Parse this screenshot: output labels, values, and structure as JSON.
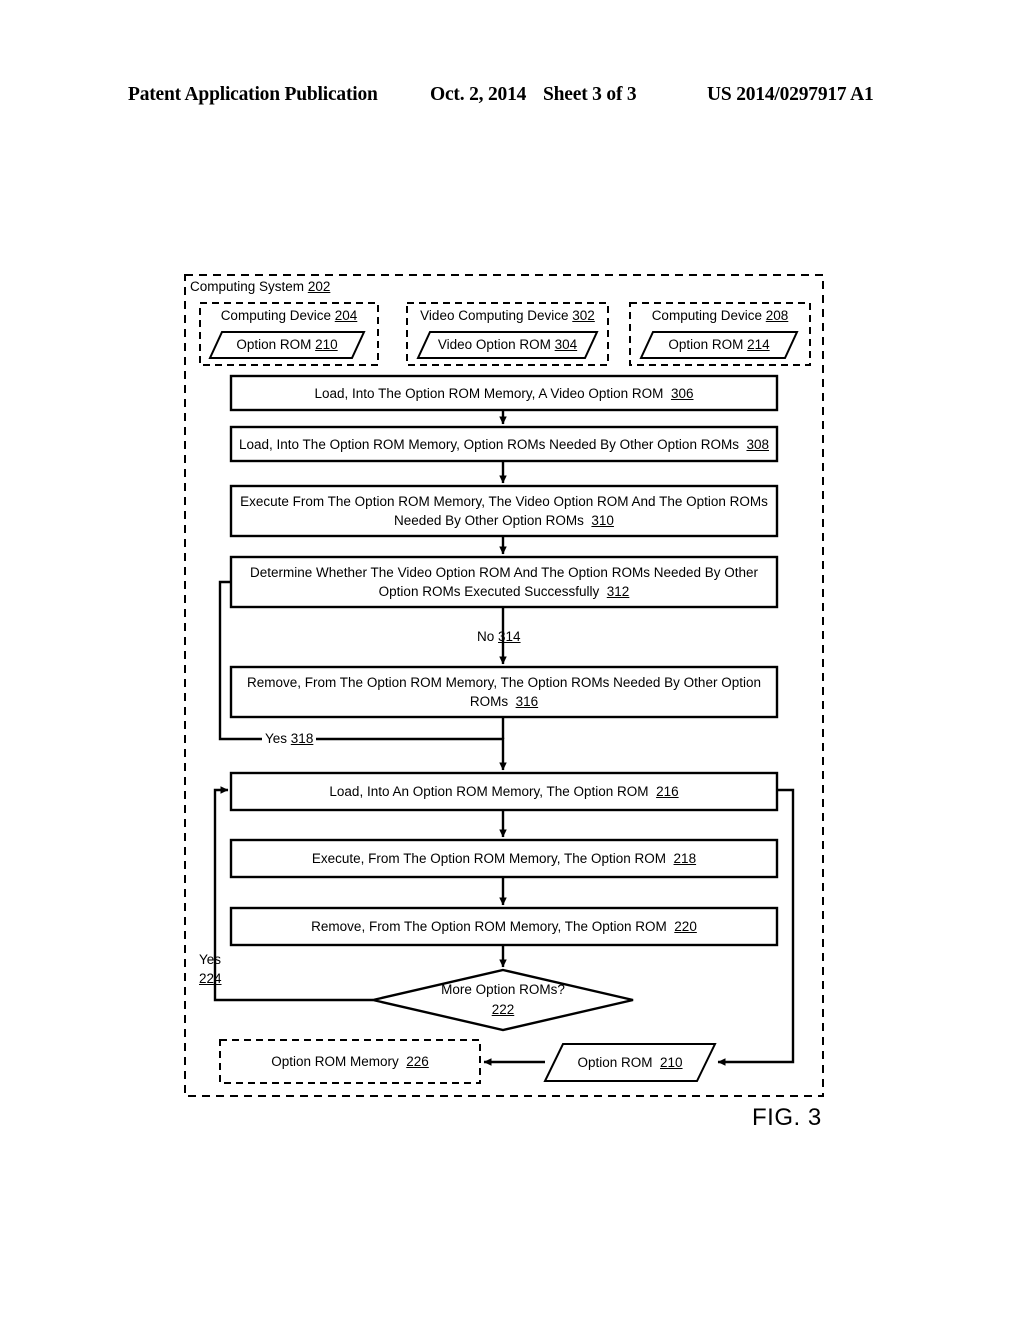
{
  "header": {
    "publication": "Patent Application Publication",
    "date": "Oct. 2, 2014",
    "sheet": "Sheet 3 of 3",
    "patent_number": "US 2014/0297917 A1"
  },
  "figure": {
    "caption": "FIG. 3",
    "system": {
      "title": "Computing System",
      "ref": "202"
    },
    "devices": [
      {
        "title": "Computing Device",
        "ref": "204",
        "rom_label": "Option ROM",
        "rom_ref": "210"
      },
      {
        "title": "Video Computing Device",
        "ref": "302",
        "rom_label": "Video Option ROM",
        "rom_ref": "304"
      },
      {
        "title": "Computing Device",
        "ref": "208",
        "rom_label": "Option ROM",
        "rom_ref": "214"
      }
    ],
    "steps": [
      {
        "id": "step-306",
        "text": "Load, Into The Option ROM Memory, A Video Option ROM",
        "ref": "306"
      },
      {
        "id": "step-308",
        "text": "Load, Into The Option ROM Memory, Option ROMs Needed By Other Option ROMs",
        "ref": "308"
      },
      {
        "id": "step-310",
        "text": "Execute From The Option ROM Memory, The Video Option ROM And The Option ROMs Needed By Other Option ROMs",
        "ref": "310"
      },
      {
        "id": "step-312",
        "text": "Determine Whether The Video Option ROM And The Option ROMs Needed By Other Option ROMs Executed Successfully",
        "ref": "312"
      },
      {
        "id": "step-316",
        "text": "Remove, From The Option ROM Memory, The Option ROMs Needed By Other Option ROMs",
        "ref": "316"
      },
      {
        "id": "step-216",
        "text": "Load, Into An Option ROM Memory, The Option ROM",
        "ref": "216"
      },
      {
        "id": "step-218",
        "text": "Execute, From The Option ROM Memory, The Option ROM",
        "ref": "218"
      },
      {
        "id": "step-220",
        "text": "Remove, From The Option ROM Memory, The Option ROM",
        "ref": "220"
      }
    ],
    "decision": {
      "text": "More Option ROMs?",
      "ref": "222"
    },
    "branches": [
      {
        "id": "branch-no-314",
        "label": "No",
        "ref": "314"
      },
      {
        "id": "branch-yes-318",
        "label": "Yes",
        "ref": "318"
      },
      {
        "id": "branch-yes-224",
        "label": "Yes",
        "ref": "224"
      }
    ],
    "memory": {
      "label": "Option ROM Memory",
      "ref": "226"
    },
    "bottom_rom": {
      "label": "Option ROM",
      "ref": "210"
    }
  }
}
